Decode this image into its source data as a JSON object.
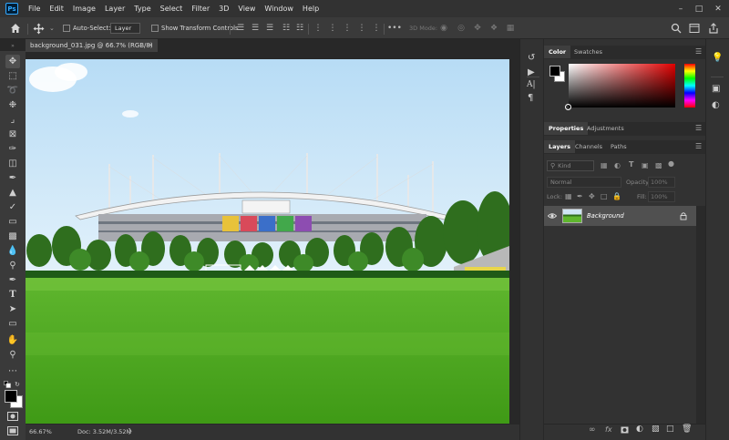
{
  "app": {
    "logo": "Ps"
  },
  "menu": [
    "File",
    "Edit",
    "Image",
    "Layer",
    "Type",
    "Select",
    "Filter",
    "3D",
    "View",
    "Window",
    "Help"
  ],
  "options_bar": {
    "auto_select_label": "Auto-Select:",
    "auto_select_target": "Layer",
    "transform_label": "Show Transform Controls",
    "mode_3d_label": "3D Mode:"
  },
  "document": {
    "tab_title": "background_031.jpg @ 66.7% (RGB/8)",
    "zoom": "66.67%",
    "doc_size": "Doc: 3.52M/3.52M"
  },
  "panels": {
    "color_tabs": [
      "Color",
      "Swatches"
    ],
    "properties_tabs": [
      "Properties",
      "Adjustments"
    ],
    "layers_tabs": [
      "Layers",
      "Channels",
      "Paths"
    ],
    "filter_kind": "Kind",
    "blend_mode": "Normal",
    "opacity_label": "Opacity:",
    "opacity_value": "100%",
    "lock_label": "Lock:",
    "fill_label": "Fill:",
    "fill_value": "100%"
  },
  "layers": [
    {
      "name": "Background",
      "visible": true,
      "locked": true
    }
  ],
  "colors": {
    "accent": "#31a8ff",
    "foreground": "#000000",
    "background": "#ffffff"
  }
}
